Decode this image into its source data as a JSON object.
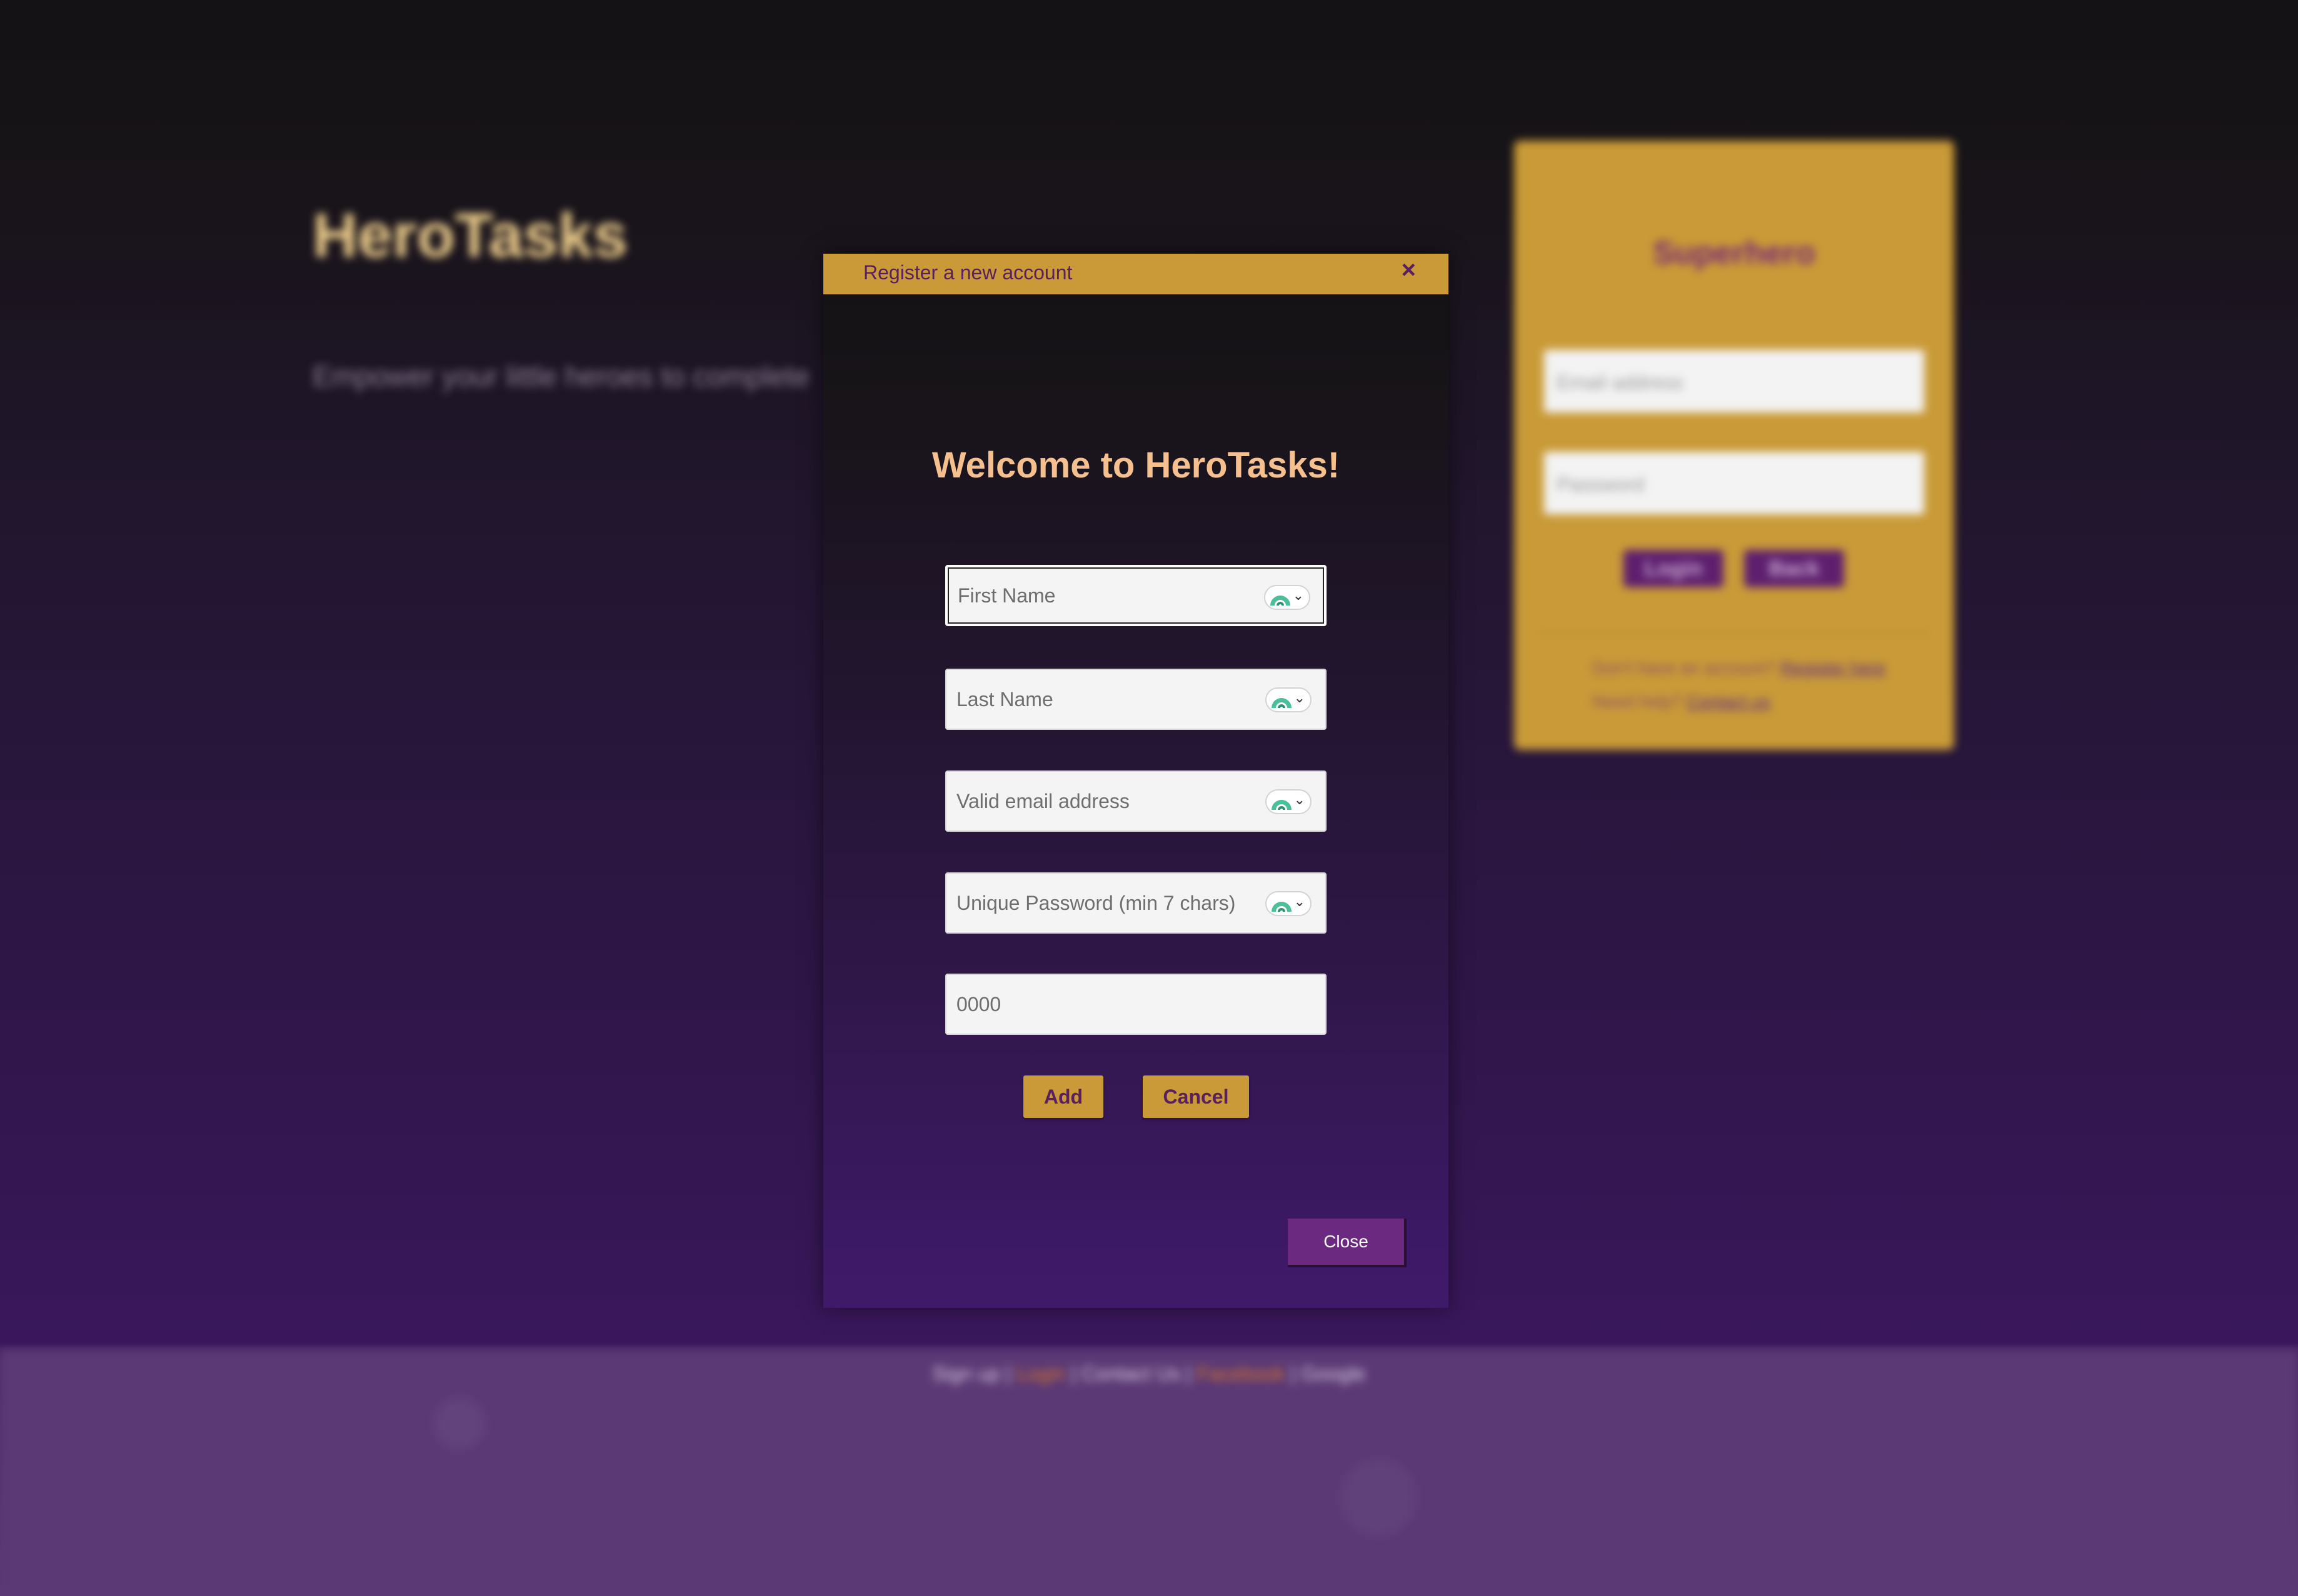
{
  "background": {
    "hero_title": "HeroTasks",
    "hero_subtitle": "Empower your little heroes to complete",
    "login": {
      "title": "Superhero",
      "email_placeholder": "Email address",
      "password_placeholder": "Password",
      "login_label": "Login",
      "back_label": "Back",
      "no_account_text": "Don't have an account?",
      "register_link": "Register here",
      "need_help_text": "Need help?",
      "contact_link": "Contact us"
    },
    "footer": {
      "links": [
        "Sign up",
        "Login",
        "Contact Us",
        "Facebook",
        "Google"
      ]
    }
  },
  "dialog": {
    "title": "Register a new account",
    "close_x": "×",
    "welcome": "Welcome to HeroTasks!",
    "fields": {
      "first_name_placeholder": "First Name",
      "last_name_placeholder": "Last Name",
      "email_placeholder": "Valid email address",
      "password_placeholder": "Unique Password (min 7 chars)",
      "pin_placeholder": "0000"
    },
    "add_label": "Add",
    "cancel_label": "Cancel",
    "close_label": "Close"
  },
  "colors": {
    "gold": "#c99a37",
    "purple_text": "#5a1f5e",
    "welcome_peach": "#f6c08e",
    "close_button": "#6b2a7f",
    "password_manager_green": "#4bbf9a"
  },
  "icons": {
    "password_manager": "password-manager-icon",
    "dropdown": "chevron-down-icon",
    "close": "close-icon"
  }
}
